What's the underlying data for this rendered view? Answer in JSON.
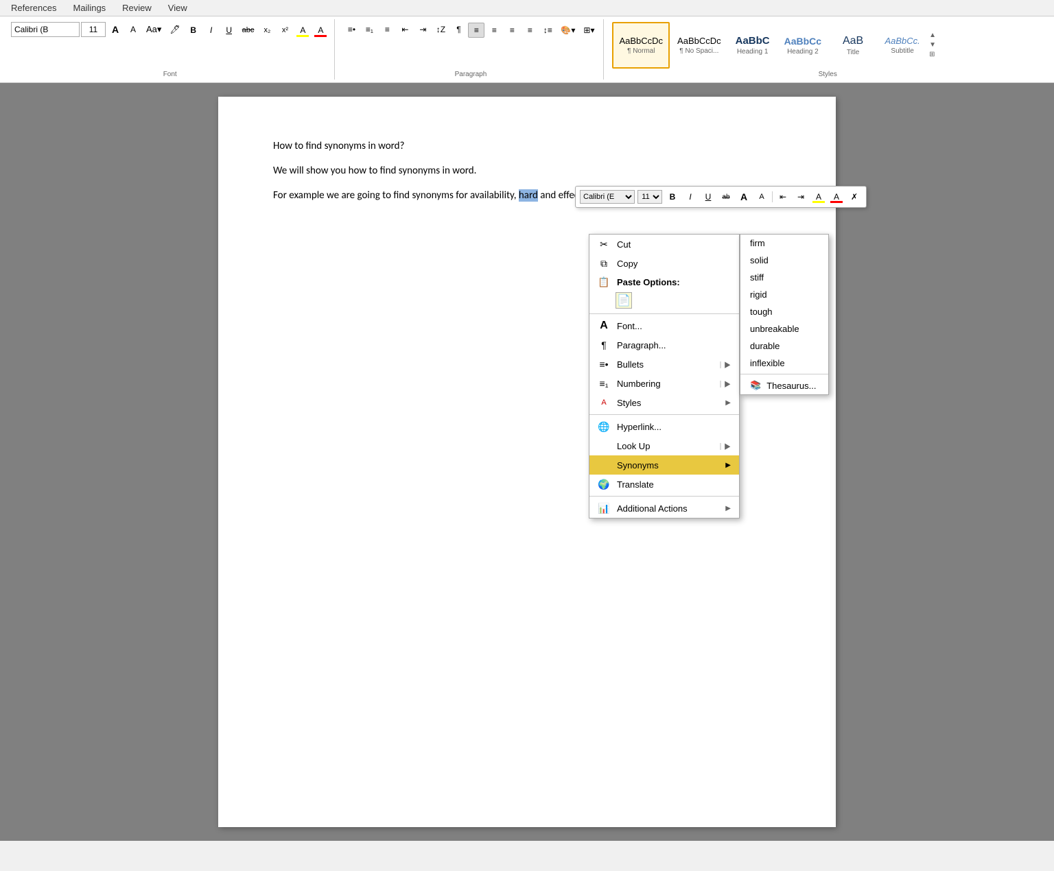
{
  "tabs": {
    "items": [
      "References",
      "Mailings",
      "Review",
      "View"
    ]
  },
  "ribbon": {
    "font_group_label": "Font",
    "paragraph_group_label": "Paragraph",
    "styles_group_label": "Styles",
    "font_name": "Calibri (B",
    "font_size": "11",
    "styles": [
      {
        "id": "normal",
        "preview": "AaBbCcDc",
        "label": "¶ Normal",
        "active": true
      },
      {
        "id": "nospace",
        "preview": "AaBbCcDc",
        "label": "¶ No Spaci...",
        "active": false
      },
      {
        "id": "h1",
        "preview": "AaBbC",
        "label": "Heading 1",
        "active": false
      },
      {
        "id": "h2",
        "preview": "AaBbCc",
        "label": "Heading 2",
        "active": false
      },
      {
        "id": "title",
        "preview": "AaB",
        "label": "Title",
        "active": false
      },
      {
        "id": "subtitle",
        "preview": "AaBbCc.",
        "label": "Subtitle",
        "active": false
      }
    ]
  },
  "document": {
    "para1": "How to find synonyms in word?",
    "para2": "We will show you how to find synonyms in word.",
    "para3_before": "For example we are going to find synonyms for availability,",
    "para3_selected": "hard",
    "para3_after": "and effects."
  },
  "mini_toolbar": {
    "font": "Calibri (E",
    "size": "11",
    "bold": "B",
    "italic": "I",
    "underline": "U",
    "strikethrough": "ab",
    "grow": "A",
    "shrink": "A",
    "align_left": "≡",
    "align_center": "≡",
    "text_color": "A",
    "eraser": "✗"
  },
  "context_menu": {
    "cut_label": "Cut",
    "copy_label": "Copy",
    "paste_label": "Paste Options:",
    "font_label": "Font...",
    "paragraph_label": "Paragraph...",
    "bullets_label": "Bullets",
    "numbering_label": "Numbering",
    "styles_label": "Styles",
    "hyperlink_label": "Hyperlink...",
    "lookup_label": "Look Up",
    "synonyms_label": "Synonyms",
    "translate_label": "Translate",
    "additional_label": "Additional Actions"
  },
  "synonyms_submenu": {
    "items": [
      "firm",
      "solid",
      "stiff",
      "rigid",
      "tough",
      "unbreakable",
      "durable",
      "inflexible"
    ],
    "thesaurus": "Thesaurus..."
  }
}
